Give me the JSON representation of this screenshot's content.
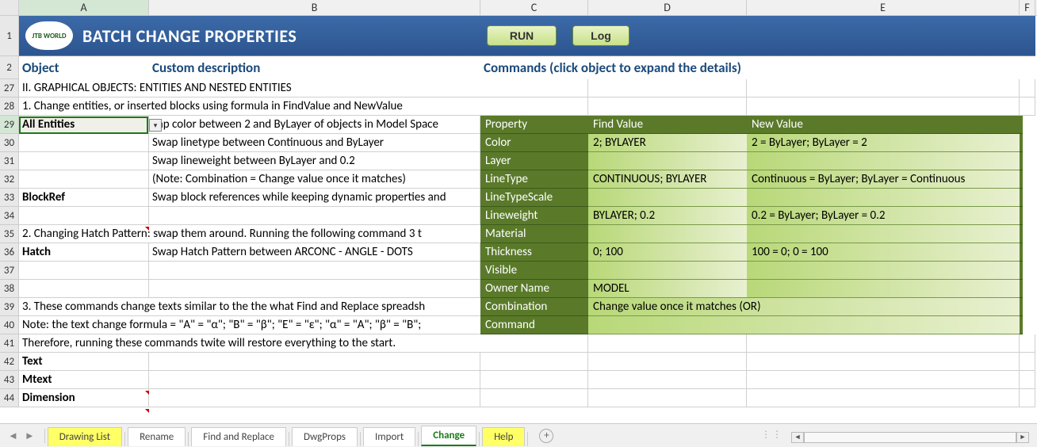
{
  "columns": [
    "A",
    "B",
    "C",
    "D",
    "E",
    "F"
  ],
  "banner": {
    "logo_text": "JTB WORLD",
    "title": "BATCH CHANGE PROPERTIES",
    "run_label": "RUN",
    "log_label": "Log"
  },
  "section_headers": {
    "object": "Object",
    "custom_desc": "Custom description",
    "commands": "Commands (click object to expand the details)"
  },
  "rows": [
    {
      "n": 27,
      "a": "II. GRAPHICAL OBJECTS: ENTITIES AND NESTED ENTITIES",
      "b": ""
    },
    {
      "n": 28,
      "a": "1. Change entities, or inserted blocks using formula in FindValue and NewValue",
      "b": ""
    },
    {
      "n": 29,
      "a": "All Entities",
      "b": "vap color between 2 and ByLayer of objects in Model Space"
    },
    {
      "n": 30,
      "a": "",
      "b": "Swap linetype between Continuous and ByLayer"
    },
    {
      "n": 31,
      "a": "",
      "b": "Swap lineweight between ByLayer and 0.2"
    },
    {
      "n": 32,
      "a": "",
      "b": "(Note: Combination = Change value once it matches)"
    },
    {
      "n": 33,
      "a": "BlockRef",
      "b": "Swap block references while keeping dynamic properties and"
    },
    {
      "n": 34,
      "a": "",
      "b": ""
    },
    {
      "n": 35,
      "a": "2. Changing Hatch Pattern: swap them around. Running the following command 3 t",
      "b": ""
    },
    {
      "n": 36,
      "a": "Hatch",
      "b": "Swap Hatch Pattern between ARCONC - ANGLE - DOTS"
    },
    {
      "n": 37,
      "a": "",
      "b": ""
    },
    {
      "n": 38,
      "a": "",
      "b": ""
    },
    {
      "n": 39,
      "a": "3. These commands change texts similar to the the what Find and Replace spreadsh",
      "b": ""
    },
    {
      "n": 40,
      "a": "Note: the text change formula = \"A\" = \"α\"; \"B\" = \"β\"; \"E\" = \"ε\"; \"α\" = \"A\"; \"β\" = \"B\";",
      "b": ""
    },
    {
      "n": 41,
      "a": "Therefore, running these commands twite will restore everything to the start.",
      "b": ""
    },
    {
      "n": 42,
      "a": "Text",
      "b": ""
    },
    {
      "n": 43,
      "a": "Mtext",
      "b": ""
    },
    {
      "n": 44,
      "a": "Dimension",
      "b": ""
    }
  ],
  "commands_panel": {
    "header": {
      "c": "Property",
      "d": "Find Value",
      "e": "New Value"
    },
    "rows": [
      {
        "c": "Color",
        "d": "2; BYLAYER",
        "e": "2 = ByLayer; ByLayer = 2"
      },
      {
        "c": "Layer",
        "d": "",
        "e": ""
      },
      {
        "c": "LineType",
        "d": "CONTINUOUS; BYLAYER",
        "e": "Continuous =  ByLayer; ByLayer = Continuous"
      },
      {
        "c": "LineTypeScale",
        "d": "",
        "e": ""
      },
      {
        "c": "Lineweight",
        "d": "BYLAYER; 0.2",
        "e": "0.2 = ByLayer; ByLayer = 0.2"
      },
      {
        "c": "Material",
        "d": "",
        "e": ""
      },
      {
        "c": "Thickness",
        "d": "0; 100",
        "e": "100 = 0; 0 = 100"
      },
      {
        "c": "Visible",
        "d": "",
        "e": ""
      },
      {
        "c": "Owner Name",
        "d": "MODEL",
        "e": ""
      },
      {
        "c": "Combination",
        "d_span": "Change value once it matches (OR)"
      },
      {
        "c": "Command",
        "d_span": ""
      }
    ]
  },
  "tabs": [
    "Drawing List",
    "Rename",
    "Find and Replace",
    "DwgProps",
    "Import",
    "Change",
    "Help"
  ],
  "active_tab": "Change",
  "yellow_tabs": [
    "Drawing List",
    "Help"
  ]
}
